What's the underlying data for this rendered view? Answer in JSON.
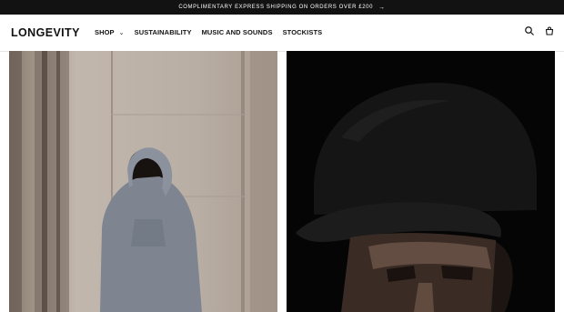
{
  "announcement": {
    "text": "COMPLIMENTARY EXPRESS SHIPPING ON ORDERS OVER £200",
    "arrow": "→"
  },
  "header": {
    "logo": "LONGEVITY",
    "nav": [
      {
        "label": "SHOP",
        "chevron": "⌄"
      },
      {
        "label": "SUSTAINABILITY"
      },
      {
        "label": "MUSIC AND SOUNDS"
      },
      {
        "label": "STOCKISTS"
      }
    ],
    "icons": [
      "search-icon",
      "cart-icon"
    ]
  },
  "colors": {
    "announcement_bg": "#121212",
    "text": "#121212",
    "right_bg": "#050505"
  }
}
